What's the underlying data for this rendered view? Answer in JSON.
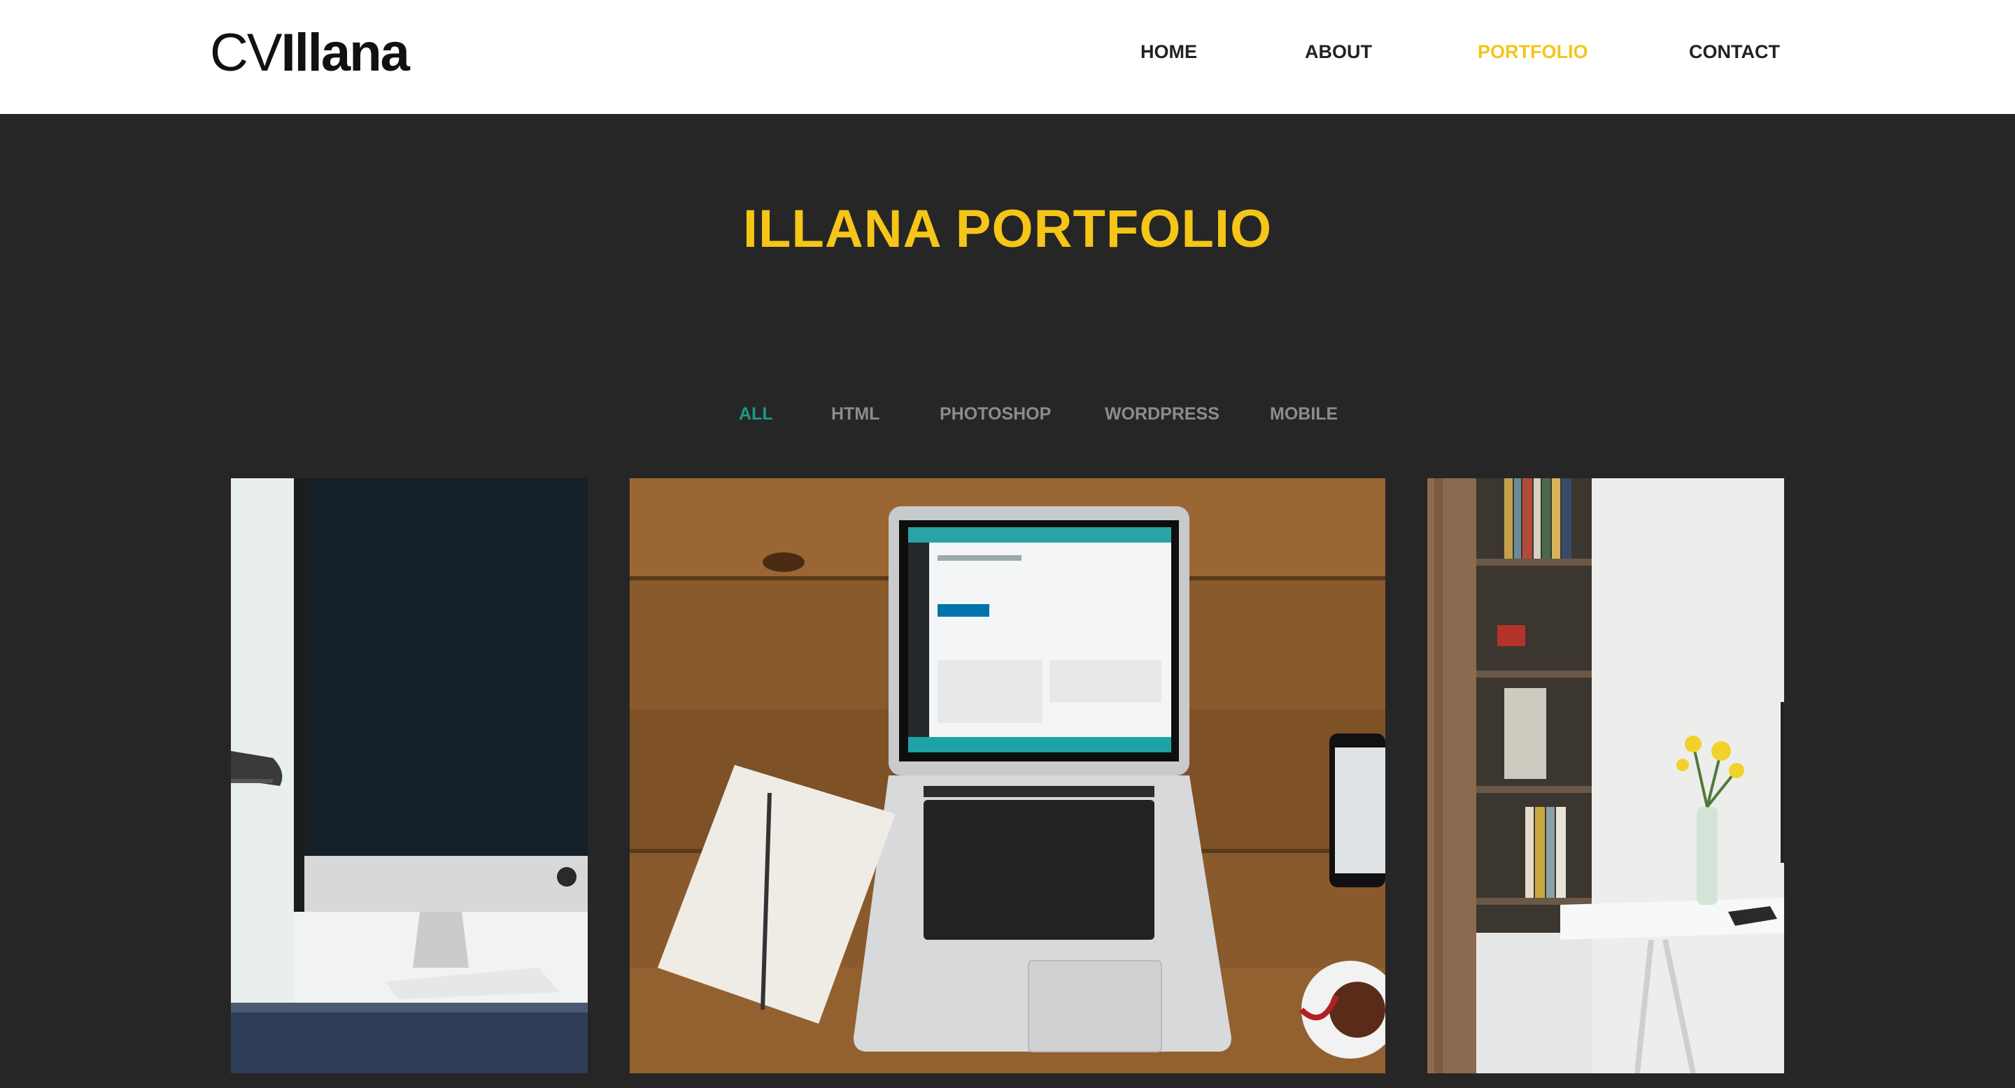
{
  "logo": {
    "light": "CV",
    "bold": "Illana"
  },
  "nav": {
    "items": [
      {
        "label": "HOME",
        "active": false
      },
      {
        "label": "ABOUT",
        "active": false
      },
      {
        "label": "PORTFOLIO",
        "active": true
      },
      {
        "label": "CONTACT",
        "active": false
      }
    ]
  },
  "hero": {
    "title": "ILLANA PORTFOLIO"
  },
  "filters": {
    "items": [
      {
        "label": "ALL",
        "active": true
      },
      {
        "label": "HTML",
        "active": false
      },
      {
        "label": "PHOTOSHOP",
        "active": false
      },
      {
        "label": "WORDPRESS",
        "active": false
      },
      {
        "label": "MOBILE",
        "active": false
      }
    ]
  },
  "portfolio": {
    "items": [
      {
        "image": "imac-desk-photo"
      },
      {
        "image": "laptop-workspace-photo"
      },
      {
        "image": "bookshelf-desk-photo"
      }
    ]
  },
  "colors": {
    "accent": "#f5c518",
    "filter_active": "#1a9a82",
    "background": "#262626",
    "header": "#ffffff"
  }
}
